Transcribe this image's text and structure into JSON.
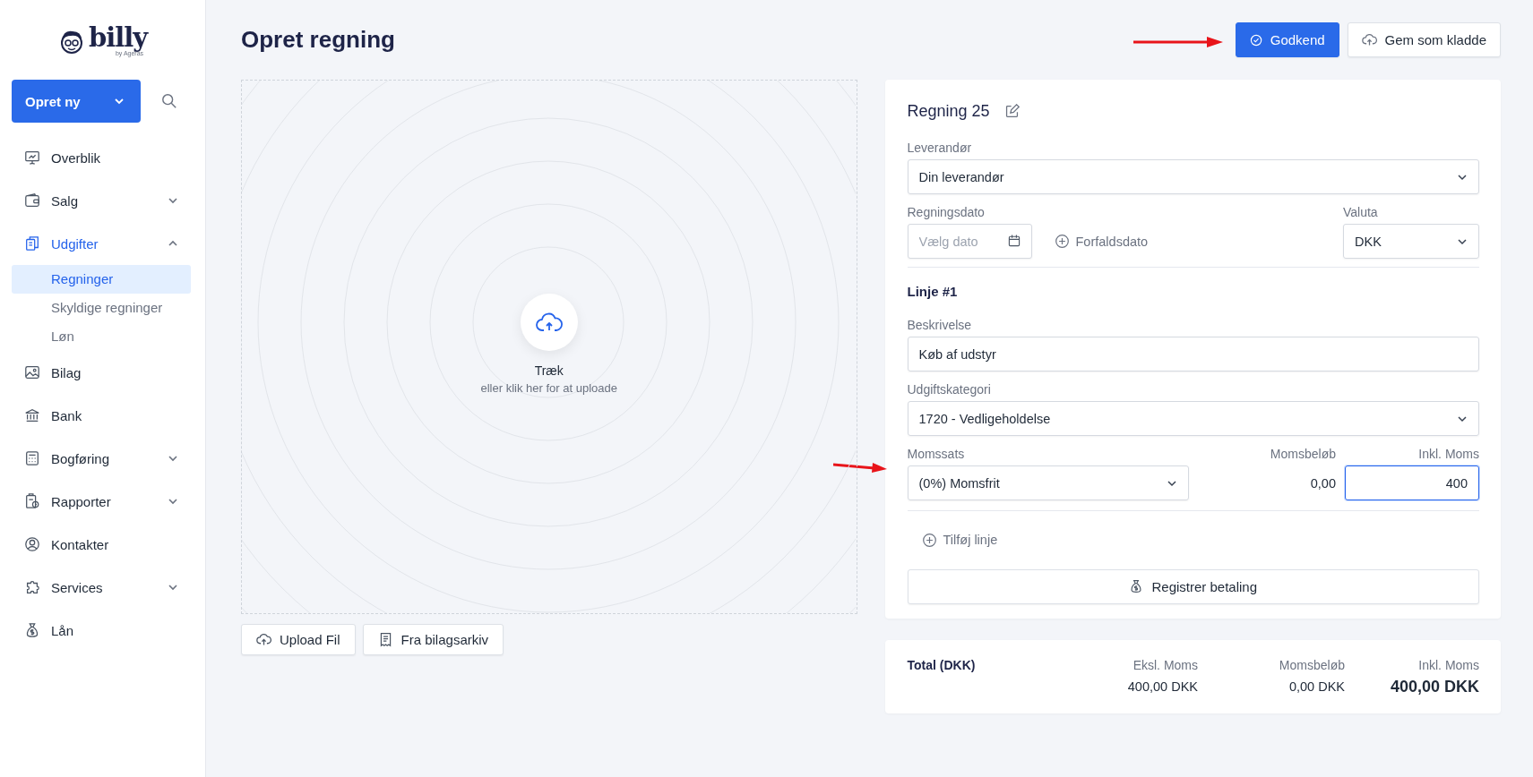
{
  "brand": {
    "name": "billy",
    "tagline": "by Ageras"
  },
  "create_button": {
    "label": "Opret ny"
  },
  "nav": [
    {
      "label": "Overblik",
      "selected": false
    },
    {
      "label": "Salg",
      "expanded": false,
      "selected": false
    },
    {
      "label": "Udgifter",
      "expanded": true,
      "selected": true,
      "children": [
        {
          "label": "Regninger",
          "selected": true
        },
        {
          "label": "Skyldige regninger",
          "selected": false
        },
        {
          "label": "Løn",
          "selected": false
        }
      ]
    },
    {
      "label": "Bilag",
      "selected": false
    },
    {
      "label": "Bank",
      "selected": false
    },
    {
      "label": "Bogføring",
      "expanded": false,
      "selected": false
    },
    {
      "label": "Rapporter",
      "expanded": false,
      "selected": false
    },
    {
      "label": "Kontakter",
      "selected": false
    },
    {
      "label": "Services",
      "expanded": false,
      "selected": false
    },
    {
      "label": "Lån",
      "selected": false
    }
  ],
  "page": {
    "title": "Opret regning",
    "actions": [
      {
        "label": "Godkend",
        "kind": "primary"
      },
      {
        "label": "Gem som kladde",
        "kind": "secondary"
      }
    ]
  },
  "upload": {
    "title": "Træk",
    "hint": "eller klik her for at uploade",
    "buttons": [
      {
        "label": "Upload Fil"
      },
      {
        "label": "Fra bilagsarkiv"
      }
    ]
  },
  "bill": {
    "title": "Regning 25",
    "supplier": {
      "label": "Leverandør",
      "value": "Din leverandør"
    },
    "date": {
      "label": "Regningsdato",
      "placeholder": "Vælg dato"
    },
    "due_date_link": "Forfaldsdato",
    "currency": {
      "label": "Valuta",
      "value": "DKK"
    },
    "lines": [
      {
        "title": "Linje #1",
        "description": {
          "label": "Beskrivelse",
          "value": "Køb af udstyr"
        },
        "category": {
          "label": "Udgiftskategori",
          "value": "1720 - Vedligeholdelse"
        },
        "vat_rate": {
          "label": "Momssats",
          "value": "(0%) Momsfrit"
        },
        "vat_amount": {
          "label": "Momsbeløb",
          "value": "0,00"
        },
        "incl_vat": {
          "label": "Inkl. Moms",
          "value": "400",
          "focused": true
        }
      }
    ],
    "add_line": "Tilføj linje",
    "register_payment": "Registrer betaling"
  },
  "totals": {
    "title": "Total (DKK)",
    "columns": [
      {
        "label": "Eksl. Moms",
        "value": "400,00 DKK",
        "emphasis": false
      },
      {
        "label": "Momsbeløb",
        "value": "0,00 DKK",
        "emphasis": false
      },
      {
        "label": "Inkl. Moms",
        "value": "400,00 DKK",
        "emphasis": true
      }
    ]
  }
}
